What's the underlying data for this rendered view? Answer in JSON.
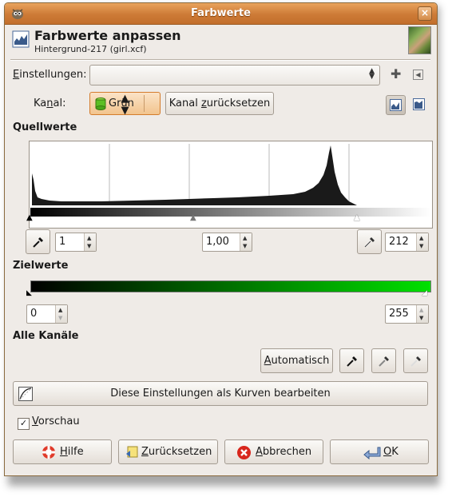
{
  "window": {
    "title": "Farbwerte"
  },
  "header": {
    "title": "Farbwerte anpassen",
    "subtitle": "Hintergrund-217 (girl.xcf)"
  },
  "settings": {
    "label_pre": "",
    "label_mn": "E",
    "label_post": "instellungen:",
    "value": ""
  },
  "channel": {
    "label_pre": "Ka",
    "label_mn": "n",
    "label_post": "al:",
    "value": "Grün",
    "reset_pre": "Kanal ",
    "reset_mn": "z",
    "reset_post": "urücksetzen"
  },
  "source": {
    "title": "Quellwerte",
    "low": "1",
    "gamma": "1,00",
    "high": "212"
  },
  "target": {
    "title": "Zielwerte",
    "low": "0",
    "high": "255"
  },
  "all_channels": {
    "title": "Alle Kanäle",
    "auto_button": "Automatisch",
    "auto_mn": "A"
  },
  "curves_button": "Diese Einstellungen als Kurven bearbeiten",
  "preview": {
    "label_pre": "",
    "label_mn": "V",
    "label_post": "orschau",
    "checked": true
  },
  "buttons": {
    "help_mn": "H",
    "help_post": "ilfe",
    "reset_mn": "Z",
    "reset_post": "urücksetzen",
    "cancel_mn": "A",
    "cancel_post": "bbrechen",
    "ok_mn": "O",
    "ok_post": "K"
  },
  "colors": {
    "titlebar": "#cd7a36",
    "focus": "#f2c48e",
    "green": "#00e000"
  }
}
